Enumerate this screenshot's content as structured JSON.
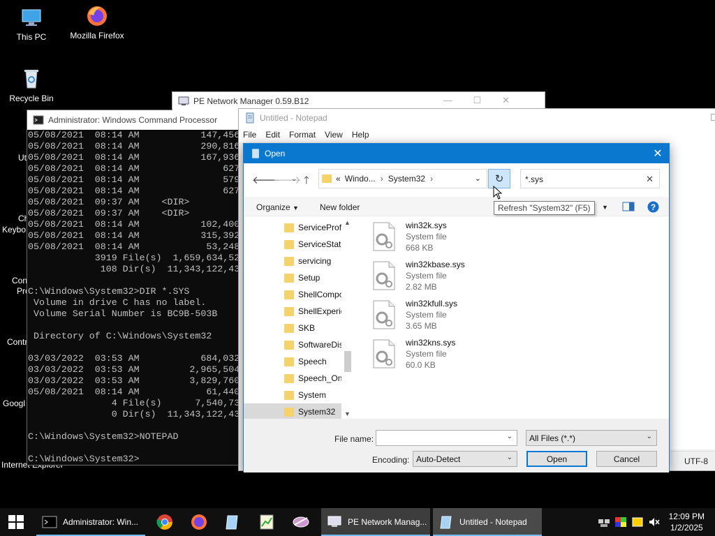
{
  "desktop": {
    "icons": [
      {
        "label": "This PC"
      },
      {
        "label": "Mozilla Firefox"
      },
      {
        "label": "Recycle Bin"
      }
    ],
    "partial_labels": [
      "Uti",
      "Ch",
      "Keybo",
      "Con",
      "Pro",
      "Contr",
      "Googl",
      "Internet Explorer"
    ]
  },
  "cmd": {
    "title": "Administrator: Windows Command Processor",
    "lines": [
      "05/08/2021  08:14 AM           147,456",
      "05/08/2021  08:14 AM           290,816",
      "05/08/2021  08:14 AM           167,936",
      "05/08/2021  08:14 AM               627",
      "05/08/2021  08:14 AM               579",
      "05/08/2021  08:14 AM               627",
      "05/08/2021  09:37 AM    <DIR>",
      "05/08/2021  09:37 AM    <DIR>",
      "05/08/2021  08:14 AM           102,400",
      "05/08/2021  08:14 AM           315,392",
      "05/08/2021  08:14 AM            53,248",
      "            3919 File(s)  1,659,634,52",
      "             108 Dir(s)  11,343,122,43",
      "",
      "C:\\Windows\\System32>DIR *.SYS",
      " Volume in drive C has no label.",
      " Volume Serial Number is BC9B-503B",
      "",
      " Directory of C:\\Windows\\System32",
      "",
      "03/03/2022  03:53 AM           684,032",
      "03/03/2022  03:53 AM         2,965,504",
      "03/03/2022  03:53 AM         3,829,760",
      "05/08/2021  08:14 AM            61,440",
      "               4 File(s)      7,540,73",
      "               0 Dir(s)  11,343,122,43",
      "",
      "C:\\Windows\\System32>NOTEPAD",
      "",
      "C:\\Windows\\System32>"
    ]
  },
  "pe": {
    "title": "PE Network Manager 0.59.B12"
  },
  "notepad": {
    "title": "Untitled - Notepad",
    "menu": [
      "File",
      "Edit",
      "Format",
      "View",
      "Help"
    ],
    "encoding_status": "UTF-8"
  },
  "dialog": {
    "title": "Open",
    "breadcrumb": {
      "prefix": "«",
      "part1": "Windo...",
      "part2": "System32"
    },
    "search_value": "*.sys",
    "tooltip": "Refresh \"System32\" (F5)",
    "toolbar": {
      "organize": "Organize",
      "new_folder": "New folder"
    },
    "tree": [
      "ServiceProfi",
      "ServiceState",
      "servicing",
      "Setup",
      "ShellCompo",
      "ShellExperie",
      "SKB",
      "SoftwareDis",
      "Speech",
      "Speech_One",
      "System",
      "System32"
    ],
    "tree_selected": "System32",
    "files": [
      {
        "name": "win32k.sys",
        "type": "System file",
        "size": "668 KB"
      },
      {
        "name": "win32kbase.sys",
        "type": "System file",
        "size": "2.82 MB"
      },
      {
        "name": "win32kfull.sys",
        "type": "System file",
        "size": "3.65 MB"
      },
      {
        "name": "win32kns.sys",
        "type": "System file",
        "size": "60.0 KB"
      }
    ],
    "file_name_label": "File name:",
    "file_name_value": "",
    "filter_value": "All Files  (*.*)",
    "encoding_label": "Encoding:",
    "encoding_value": "Auto-Detect",
    "open_label": "Open",
    "cancel_label": "Cancel"
  },
  "taskbar": {
    "buttons": [
      {
        "label": "Administrator: Win..."
      },
      {
        "label": "PE Network Manag..."
      },
      {
        "label": "Untitled - Notepad"
      }
    ],
    "time": "12:09 PM",
    "date": "1/2/2025"
  },
  "colors": {
    "accent": "#0078d7",
    "folder": "#f6d36a",
    "taskbar": "#101010"
  }
}
